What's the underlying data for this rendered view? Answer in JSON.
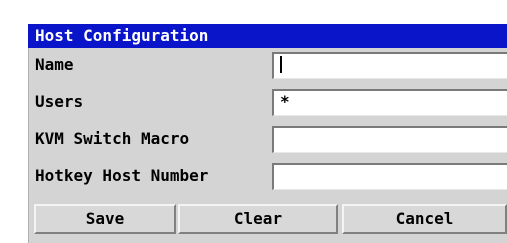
{
  "dialog": {
    "title": "Host Configuration"
  },
  "fields": [
    {
      "label": "Name",
      "value": "",
      "has_cursor": true
    },
    {
      "label": "Users",
      "value": "*"
    },
    {
      "label": "KVM Switch Macro",
      "value": ""
    },
    {
      "label": "Hotkey Host Number",
      "value": ""
    }
  ],
  "buttons": {
    "save_label": "Save",
    "clear_label": "Clear",
    "cancel_label": "Cancel"
  },
  "colors": {
    "title_bar": "#0a14c8",
    "panel": "#d4d4d4",
    "field": "#ffffff"
  }
}
